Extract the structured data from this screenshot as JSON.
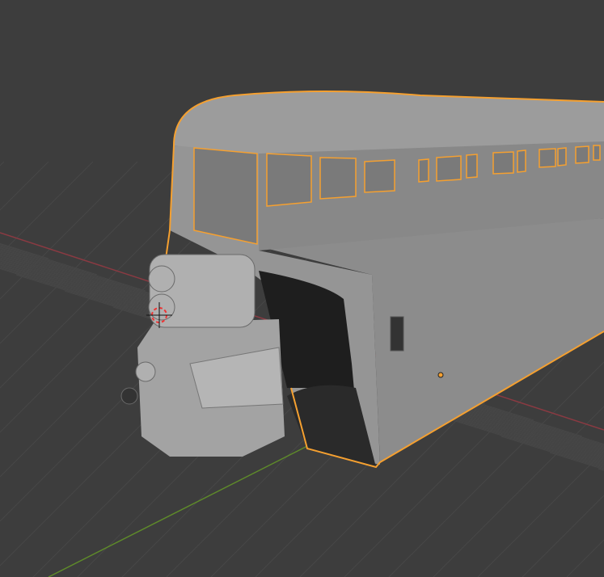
{
  "viewport": {
    "mode": "3d-viewport",
    "selected_object": "bus-body",
    "colors": {
      "background": "#3d3d3d",
      "grid": "#474747",
      "x_axis": "#8a3a42",
      "y_axis": "#5e8a2a",
      "selection_outline": "#f5a030",
      "body": "#8f8f8f",
      "body_dark": "#6e6e6e",
      "engine": "#a9a9a9",
      "wheel_well": "#1e1e1e"
    },
    "icons": [
      "3d-cursor-icon",
      "object-origin-icon"
    ]
  }
}
